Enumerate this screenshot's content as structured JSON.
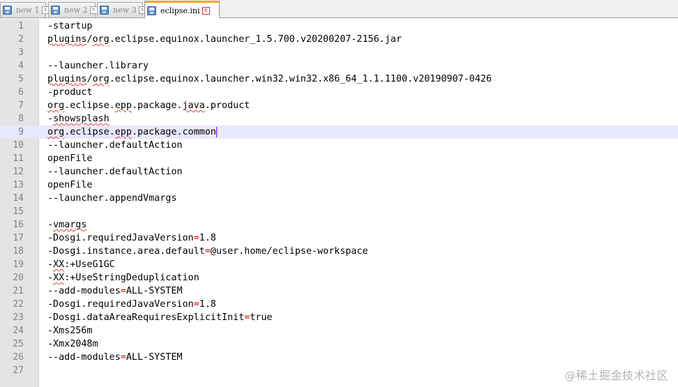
{
  "tabs": [
    {
      "label": "new 1",
      "active": false
    },
    {
      "label": "new 2",
      "active": false
    },
    {
      "label": "new 3",
      "active": false
    },
    {
      "label": "eclipse.ini",
      "active": true
    }
  ],
  "tab_close_glyph": "x",
  "icons": {
    "tab_file": "save-disk-icon",
    "tab_close": "close-icon"
  },
  "editor": {
    "current_line": 9,
    "lines": [
      {
        "number": "1",
        "text": "-startup"
      },
      {
        "number": "2",
        "text": "plugins/org.eclipse.equinox.launcher_1.5.700.v20200207-2156.jar"
      },
      {
        "number": "3",
        "text": ""
      },
      {
        "number": "4",
        "text": "--launcher.library"
      },
      {
        "number": "5",
        "text": "plugins/org.eclipse.equinox.launcher.win32.win32.x86_64_1.1.1100.v20190907-0426"
      },
      {
        "number": "6",
        "text": "-product"
      },
      {
        "number": "7",
        "text": "org.eclipse.epp.package.java.product"
      },
      {
        "number": "8",
        "text": "-showsplash"
      },
      {
        "number": "9",
        "text": "org.eclipse.epp.package.common"
      },
      {
        "number": "10",
        "text": "--launcher.defaultAction"
      },
      {
        "number": "11",
        "text": "openFile"
      },
      {
        "number": "12",
        "text": "--launcher.defaultAction"
      },
      {
        "number": "13",
        "text": "openFile"
      },
      {
        "number": "14",
        "text": "--launcher.appendVmargs"
      },
      {
        "number": "15",
        "text": ""
      },
      {
        "number": "16",
        "text": "-vmargs"
      },
      {
        "number": "17",
        "text": "-Dosgi.requiredJavaVersion=1.8"
      },
      {
        "number": "18",
        "text": "-Dosgi.instance.area.default=@user.home/eclipse-workspace"
      },
      {
        "number": "19",
        "text": "-XX:+UseG1GC"
      },
      {
        "number": "20",
        "text": "-XX:+UseStringDeduplication"
      },
      {
        "number": "21",
        "text": "--add-modules=ALL-SYSTEM"
      },
      {
        "number": "22",
        "text": "-Dosgi.requiredJavaVersion=1.8"
      },
      {
        "number": "23",
        "text": "-Dosgi.dataAreaRequiresExplicitInit=true"
      },
      {
        "number": "24",
        "text": "-Xms256m"
      },
      {
        "number": "25",
        "text": "-Xmx2048m"
      },
      {
        "number": "26",
        "text": "--add-modules=ALL-SYSTEM"
      },
      {
        "number": "27",
        "text": ""
      }
    ]
  },
  "watermark": "@稀土掘金技术社区",
  "colors": {
    "operator": "#e00000",
    "current_line": "#e8e8ff",
    "active_tab_accent": "#f5a623",
    "spellcheck": "#e03c3c"
  }
}
